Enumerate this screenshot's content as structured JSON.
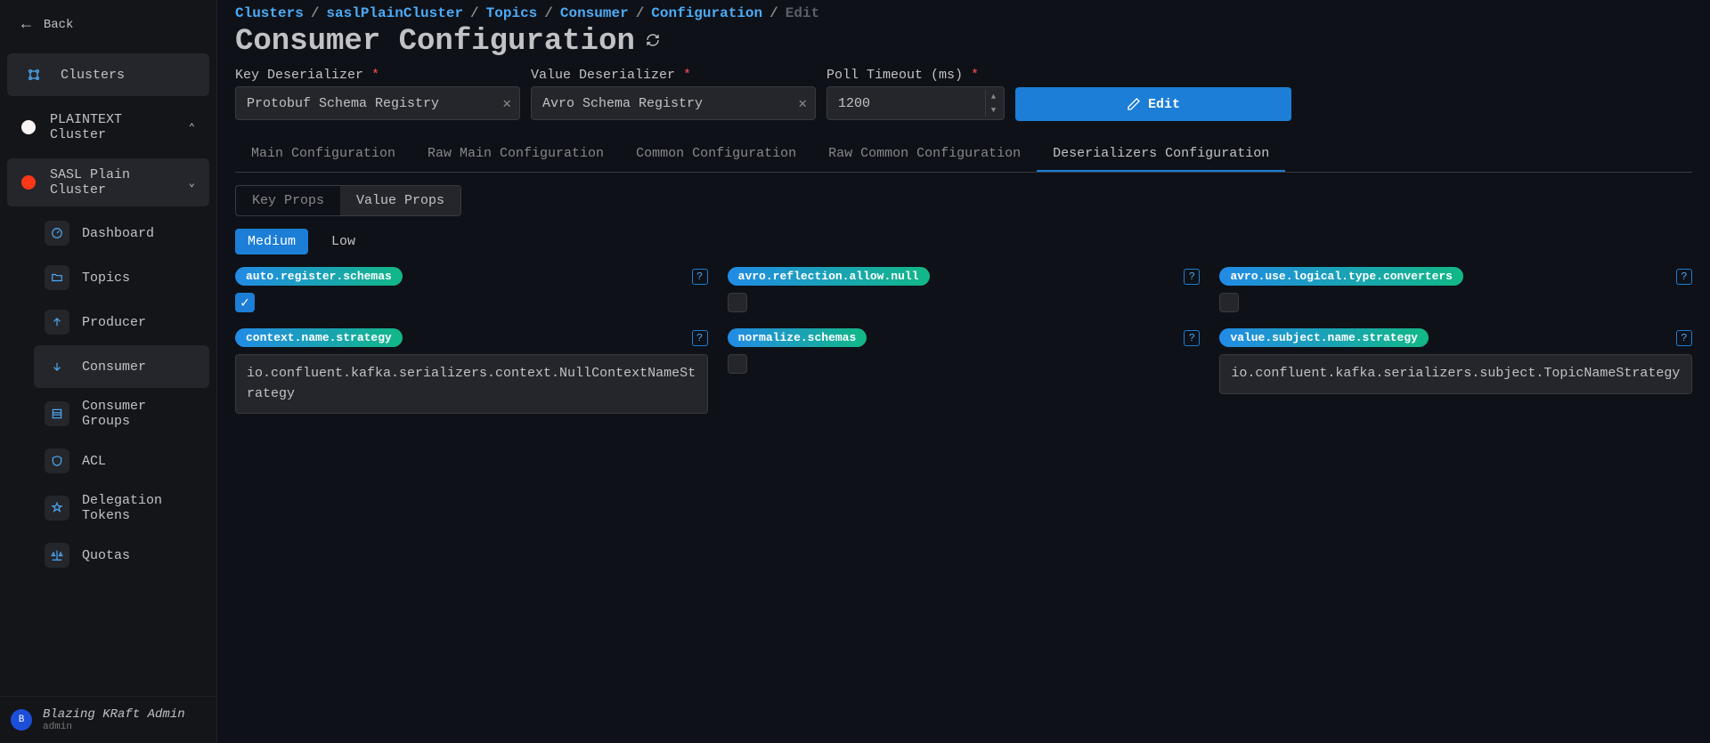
{
  "sidebar": {
    "back": "Back",
    "clusters_label": "Clusters",
    "cluster_groups": [
      {
        "label": "PLAINTEXT Cluster",
        "dot": "white",
        "expanded": false
      },
      {
        "label": "SASL Plain Cluster",
        "dot": "red",
        "expanded": true
      }
    ],
    "items": [
      {
        "label": "Dashboard",
        "icon": "gauge"
      },
      {
        "label": "Topics",
        "icon": "folder"
      },
      {
        "label": "Producer",
        "icon": "upload"
      },
      {
        "label": "Consumer",
        "icon": "download",
        "selected": true
      },
      {
        "label": "Consumer Groups",
        "icon": "list"
      },
      {
        "label": "ACL",
        "icon": "shield"
      },
      {
        "label": "Delegation Tokens",
        "icon": "star"
      },
      {
        "label": "Quotas",
        "icon": "scale"
      }
    ],
    "user": {
      "name": "Blazing KRaft Admin",
      "role": "admin",
      "initial": "B"
    }
  },
  "breadcrumb": [
    "Clusters",
    "saslPlainCluster",
    "Topics",
    "Consumer",
    "Configuration"
  ],
  "breadcrumb_current": "Edit",
  "page_title": "Consumer Configuration",
  "form": {
    "key_deser_label": "Key Deserializer",
    "key_deser_value": "Protobuf Schema Registry",
    "value_deser_label": "Value Deserializer",
    "value_deser_value": "Avro Schema Registry",
    "poll_label": "Poll Timeout (ms)",
    "poll_value": "1200",
    "edit_label": "Edit"
  },
  "tabs": [
    "Main Configuration",
    "Raw Main Configuration",
    "Common Configuration",
    "Raw Common Configuration",
    "Deserializers Configuration"
  ],
  "active_tab": 4,
  "subtabs": [
    "Key Props",
    "Value Props"
  ],
  "active_subtab": 1,
  "pills": [
    "Medium",
    "Low"
  ],
  "active_pill": 0,
  "props": [
    {
      "name": "auto.register.schemas",
      "type": "bool",
      "value": true
    },
    {
      "name": "avro.reflection.allow.null",
      "type": "bool",
      "value": false
    },
    {
      "name": "avro.use.logical.type.converters",
      "type": "bool",
      "value": false
    },
    {
      "name": "context.name.strategy",
      "type": "text",
      "value": "io.confluent.kafka.serializers.context.NullContextNameStrategy"
    },
    {
      "name": "normalize.schemas",
      "type": "bool",
      "value": false
    },
    {
      "name": "value.subject.name.strategy",
      "type": "text",
      "value": "io.confluent.kafka.serializers.subject.TopicNameStrategy"
    }
  ]
}
